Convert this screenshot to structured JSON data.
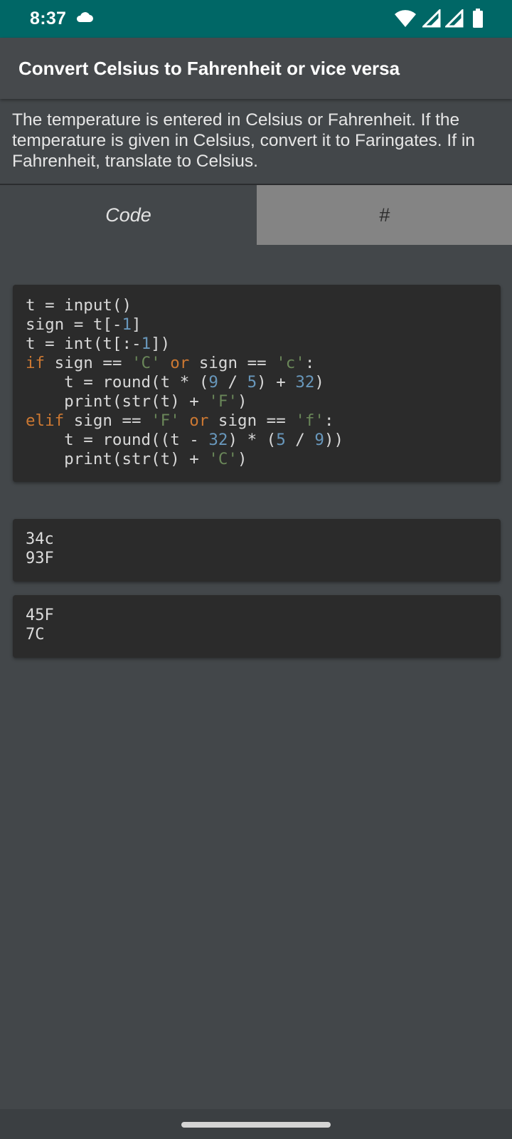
{
  "status_bar": {
    "time": "8:37",
    "icons": [
      "cloud-icon",
      "wifi-icon",
      "signal-icon",
      "signal-icon",
      "battery-icon"
    ],
    "color": "#006766"
  },
  "app_bar": {
    "title": "Convert Celsius to Fahrenheit or vice versa"
  },
  "description": "The temperature is entered in Celsius or Fahrenheit. If the temperature is given in Celsius, convert it to Faringates. If in Fahrenheit, translate to Celsius.",
  "tabs": [
    {
      "label": "Code",
      "selected": false
    },
    {
      "label": "#",
      "selected": true
    }
  ],
  "code": {
    "lines": [
      "t = input()",
      "sign = t[-1]",
      "t = int(t[:-1])",
      "if sign == 'C' or sign == 'c':",
      "    t = round(t * (9 / 5) + 32)",
      "    print(str(t) + 'F')",
      "elif sign == 'F' or sign == 'f':",
      "    t = round((t - 32) * (5 / 9))",
      "    print(str(t) + 'C')"
    ]
  },
  "examples": [
    {
      "input": "34c",
      "output": "93F"
    },
    {
      "input": "45F",
      "output": "7C"
    }
  ],
  "colors": {
    "background": "#43474a",
    "card": "#2b2b2b",
    "keyword": "#cc7832",
    "string": "#6a8759",
    "number": "#6897bb"
  }
}
